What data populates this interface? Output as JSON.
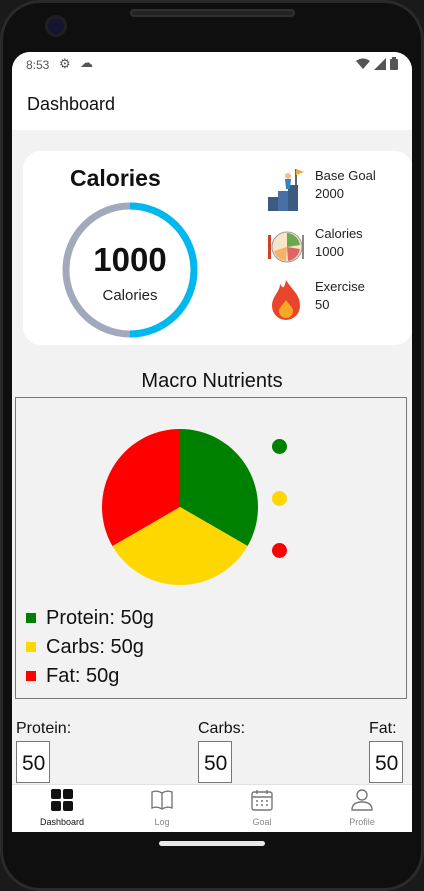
{
  "status_bar": {
    "time": "8:53"
  },
  "app_bar": {
    "title": "Dashboard"
  },
  "calories_card": {
    "title": "Calories",
    "ring_value": "1000",
    "ring_label": "Calories",
    "ring_progress_fraction": 0.5,
    "ring_progress_color": "#00b8f0",
    "ring_track_color": "#a3a9bc",
    "stats": [
      {
        "icon": "goal-flag-icon",
        "label": "Base Goal",
        "value": "2000"
      },
      {
        "icon": "food-plate-icon",
        "label": "Calories",
        "value": "1000"
      },
      {
        "icon": "fire-icon",
        "label": "Exercise",
        "value": "50"
      }
    ]
  },
  "macros": {
    "title": "Macro Nutrients",
    "legend": [
      {
        "text": "Protein: 50g",
        "color": "#008000"
      },
      {
        "text": "Carbs: 50g",
        "color": "#ffd700"
      },
      {
        "text": "Fat: 50g",
        "color": "#ff0000"
      }
    ]
  },
  "chart_data": {
    "type": "pie",
    "categories": [
      "Protein",
      "Carbs",
      "Fat"
    ],
    "values": [
      50,
      50,
      50
    ],
    "colors": [
      "#008000",
      "#ffd700",
      "#ff0000"
    ]
  },
  "inputs": [
    {
      "label": "Protein:",
      "value": "50"
    },
    {
      "label": "Carbs:",
      "value": "50"
    },
    {
      "label": "Fat:",
      "value": "50"
    }
  ],
  "nav": [
    {
      "label": "Dashboard",
      "icon": "dashboard-grid-icon",
      "active": true
    },
    {
      "label": "Log",
      "icon": "book-icon",
      "active": false
    },
    {
      "label": "Goal",
      "icon": "calendar-icon",
      "active": false
    },
    {
      "label": "Profile",
      "icon": "person-icon",
      "active": false
    }
  ]
}
